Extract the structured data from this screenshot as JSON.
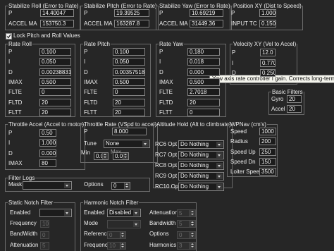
{
  "stab_roll": {
    "title": "Stabilize Roll (Error to Rate)",
    "p_label": "P",
    "p": "14.40047",
    "accel_label": "ACCEL MA",
    "accel": "153750.3"
  },
  "stab_pitch": {
    "title": "Stabilize Pitch (Error to Rate)",
    "p_label": "P",
    "p": "19.39525",
    "accel_label": "ACCEL MA",
    "accel": "163287.8"
  },
  "stab_yaw": {
    "title": "Stabilize Yaw (Error to Rate)",
    "p_label": "P",
    "p": "10.69219",
    "accel_label": "ACCEL MA",
    "accel": "31449.36"
  },
  "pos_xy": {
    "title": "Position XY (Dist to Speed)",
    "p_label": "P",
    "p": "1.000",
    "tc_label": "INPUT TC",
    "tc": "0.150"
  },
  "lock": {
    "label": "Lock Pitch and Roll Values",
    "checked": true
  },
  "rate_roll": {
    "title": "Rate Roll",
    "labels": [
      "P",
      "I",
      "D",
      "IMAX",
      "FLTE",
      "FLTD",
      "FLTT"
    ],
    "values": [
      "0.100",
      "0.050",
      "0.00238831",
      "0.500",
      "0",
      "20",
      "20"
    ]
  },
  "rate_pitch": {
    "title": "Rate Pitch",
    "labels": [
      "P",
      "I",
      "D",
      "IMAX",
      "FLTE",
      "FLTD",
      "FLTT"
    ],
    "values": [
      "0.100",
      "0.050",
      "0.00357518",
      "0.500",
      "0",
      "20",
      "20"
    ]
  },
  "rate_yaw": {
    "title": "Rate Yaw",
    "labels": [
      "P",
      "I",
      "D",
      "IMAX",
      "FLTE",
      "FLTD",
      "FLTT"
    ],
    "values": [
      "0.180",
      "0.018",
      "0.000",
      "0.500",
      "2.7018",
      "20",
      "0"
    ]
  },
  "vel_xy": {
    "title": "Velocity XY (Vel to Accel)",
    "labels": [
      "P",
      "I",
      "D"
    ],
    "values": [
      "12.0",
      "0.770",
      "0.250"
    ]
  },
  "tooltip": {
    "text": "Yaw axis rate controller I gain.  Corrects long-term differ"
  },
  "basic_filters": {
    "title": "Basic Filters",
    "gyro_label": "Gyro",
    "gyro": "20",
    "accel_label": "Accel",
    "accel": "20"
  },
  "throttle_accel": {
    "title": "Throttle Accel (Accel to motor)",
    "labels": [
      "P",
      "I",
      "D",
      "IMAX"
    ],
    "values": [
      "0.50",
      "1.000",
      "0.000",
      "80"
    ]
  },
  "throttle_rate": {
    "title": "Throttle Rate (VSpd to accel)",
    "p_label": "P",
    "p": "8.000",
    "tune_label": "Tune",
    "tune": "None",
    "min_label": "Min",
    "min": "0.000",
    "max_label": "Max",
    "max": "0.000"
  },
  "alt_hold": {
    "title": "Altitude Hold (Alt to climbrate)",
    "labels": [
      "RC6 Opt",
      "RC7 Opt",
      "RC8 Opt",
      "RC9 Opt",
      "RC10 Opt"
    ],
    "values": [
      "Do Nothing",
      "Do Nothing",
      "Do Nothing",
      "Do Nothing",
      "Do Nothing"
    ]
  },
  "wpnav": {
    "title": "WPNav (cm's)",
    "labels": [
      "Speed",
      "Radius",
      "Speed Up",
      "Speed Dn",
      "Loiter Speed"
    ],
    "values": [
      "1000",
      "200",
      "250",
      "150",
      "3500"
    ]
  },
  "filter_logs": {
    "title": "Filter Logs",
    "mask_label": "Mask",
    "mask": "",
    "options_label": "Options",
    "options": "0"
  },
  "static_notch": {
    "title": "Static Notch Filter",
    "enabled_label": "Enabled",
    "enabled": "",
    "freq_label": "Frequency",
    "freq": "10",
    "bw_label": "BandWidth",
    "bw": "0",
    "atten_label": "Attenuation",
    "atten": "5"
  },
  "harmonic_notch": {
    "title": "Harmonic Notch Filter",
    "enabled_label": "Enabled",
    "enabled": "Disabled",
    "mode_label": "Mode",
    "mode": "",
    "ref_label": "Reference",
    "ref": "0",
    "freq_label": "Frequency",
    "freq": "10",
    "atten_label": "Attenuation",
    "atten": "5",
    "bw_label": "Bandwidth",
    "bw": "5",
    "opt_label": "Options",
    "opt": "0",
    "harm_label": "Harmonics",
    "harm": "3"
  }
}
